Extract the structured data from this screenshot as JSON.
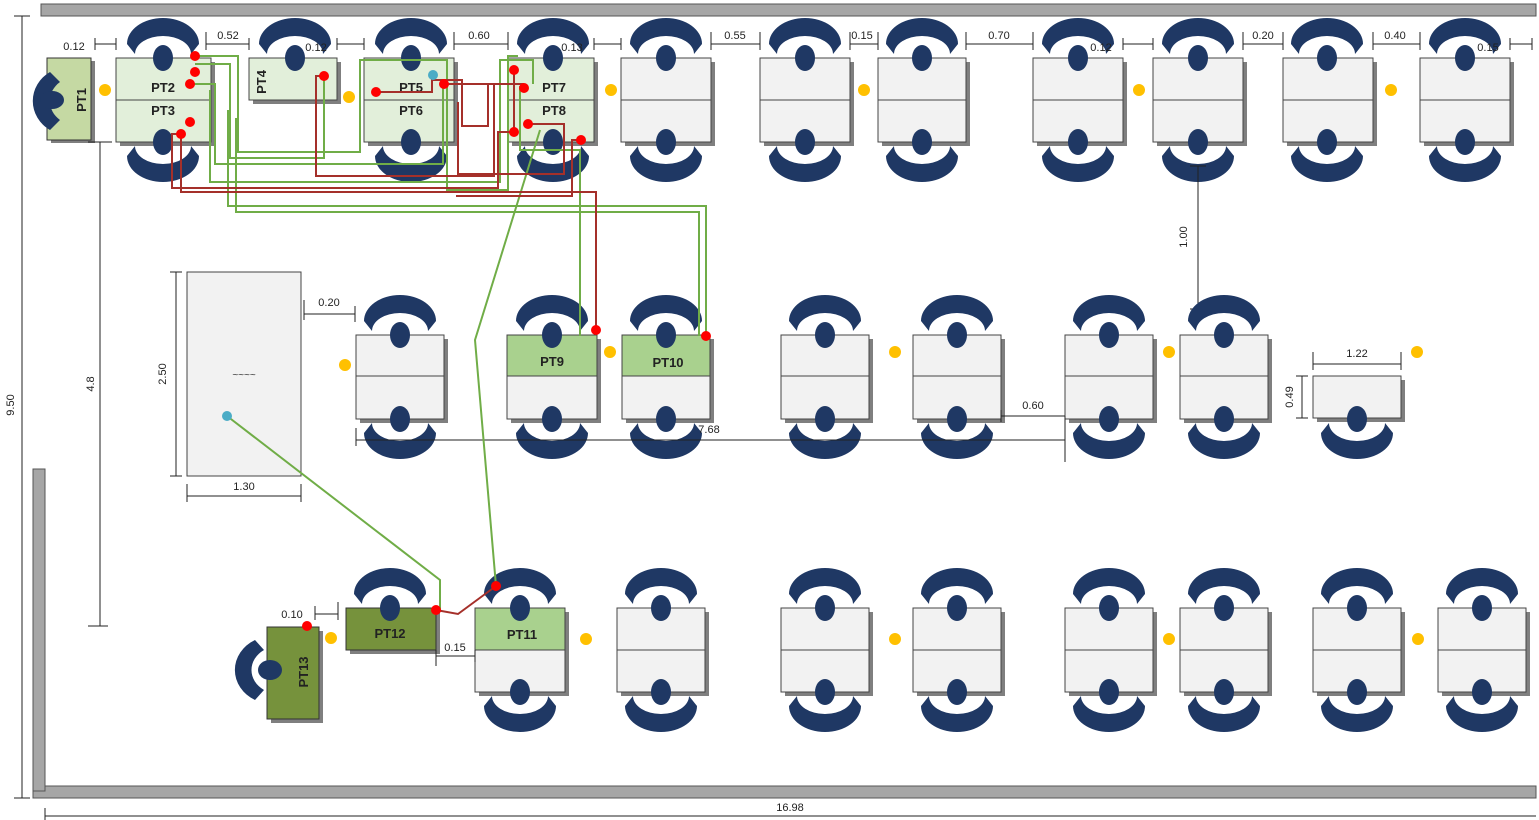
{
  "plan": {
    "room": {
      "width_label": "16.98",
      "height_label": "9.50"
    },
    "colors": {
      "wall": "#a6a6a6",
      "desk": "#f2f2f2",
      "desk_light_green": "#e2efda",
      "desk_mid_green": "#a9d18e",
      "desk_dark_green": "#76923c",
      "chair": "#1f3864",
      "socket": "#ffc000",
      "cable_green": "#70ad47",
      "cable_red": "#a5302a",
      "node_red": "#ff0000",
      "node_cyan": "#4bacc6"
    },
    "workstations": [
      {
        "id": "PT1",
        "label": "PT1"
      },
      {
        "id": "PT2",
        "label": "PT2"
      },
      {
        "id": "PT3",
        "label": "PT3"
      },
      {
        "id": "PT4",
        "label": "PT4"
      },
      {
        "id": "PT5",
        "label": "PT5"
      },
      {
        "id": "PT6",
        "label": "PT6"
      },
      {
        "id": "PT7",
        "label": "PT7"
      },
      {
        "id": "PT8",
        "label": "PT8"
      },
      {
        "id": "PT9",
        "label": "PT9"
      },
      {
        "id": "PT10",
        "label": "PT10"
      },
      {
        "id": "PT11",
        "label": "PT11"
      },
      {
        "id": "PT12",
        "label": "PT12"
      },
      {
        "id": "PT13",
        "label": "PT13"
      }
    ],
    "dimensions": {
      "d012a": "0.12",
      "d052": "0.52",
      "d012b": "0.12",
      "d060a": "0.60",
      "d013": "0.13",
      "d055": "0.55",
      "d015a": "0.15",
      "d070": "0.70",
      "d012c": "0.12",
      "d020a": "0.20",
      "d040": "0.40",
      "d015b": "0.15",
      "d100": "1.00",
      "d48": "4.8",
      "d250": "2.50",
      "d130": "1.30",
      "d020b": "0.20",
      "d768": "7.68",
      "d060b": "0.60",
      "d122": "1.22",
      "d049": "0.49",
      "d010": "0.10",
      "d015c": "0.15"
    },
    "cabinet_mark": "~~~~"
  }
}
